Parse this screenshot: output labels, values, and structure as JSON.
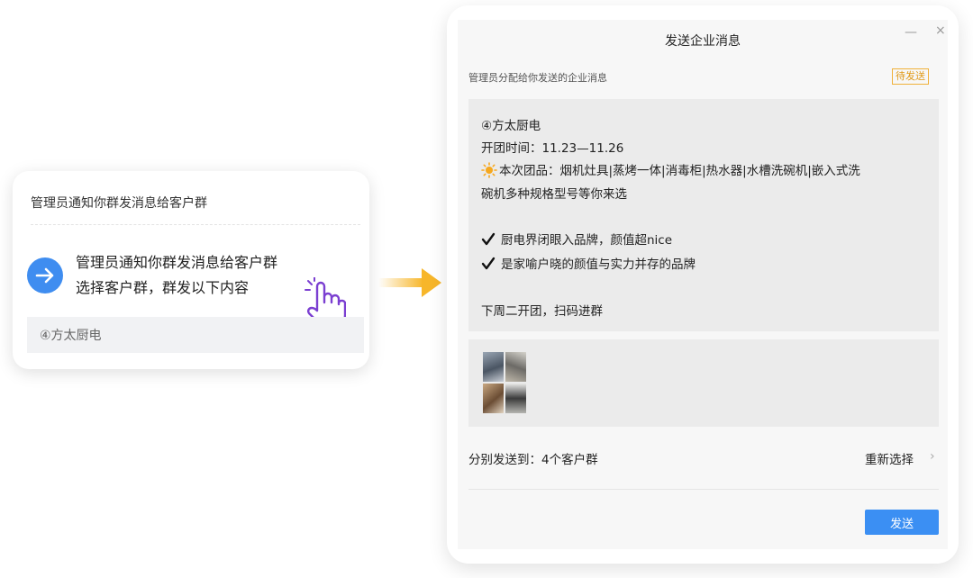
{
  "notice": {
    "title": "管理员通知你群发消息给客户群",
    "line1": "管理员通知你群发消息给客户群",
    "line2": "选择客户群，群发以下内容",
    "preview": "④方太厨电"
  },
  "dialog": {
    "title": "发送企业消息",
    "minimize": "—",
    "close": "×",
    "subtitle": "管理员分配给你发送的企业消息",
    "status_badge": "待发送",
    "message": {
      "line1": "④方太厨电",
      "line2": "开团时间：11.23—11.26",
      "line3": "本次团品：烟机灶具|蒸烤一体|消毒柜|热水器|水槽洗碗机|嵌入式洗",
      "line4": "碗机多种规格型号等你来选",
      "line5": "厨电界闭眼入品牌，颜值超nice",
      "line6": "是家喻户晓的颜值与实力并存的品牌",
      "line7": "下周二开团，扫码进群"
    },
    "send_to_label": "分别发送到：4个客户群",
    "reselect_label": "重新选择",
    "reselect_chevron": "›",
    "send_button": "发送"
  },
  "colors": {
    "accent": "#3b8ff3",
    "badge": "#e09a1a",
    "arrow": "#f7b62a"
  },
  "icons": [
    "arrow-right-icon",
    "hand-pointer-icon",
    "flow-arrow-icon",
    "sun-icon",
    "check-icon",
    "chevron-right-icon"
  ]
}
